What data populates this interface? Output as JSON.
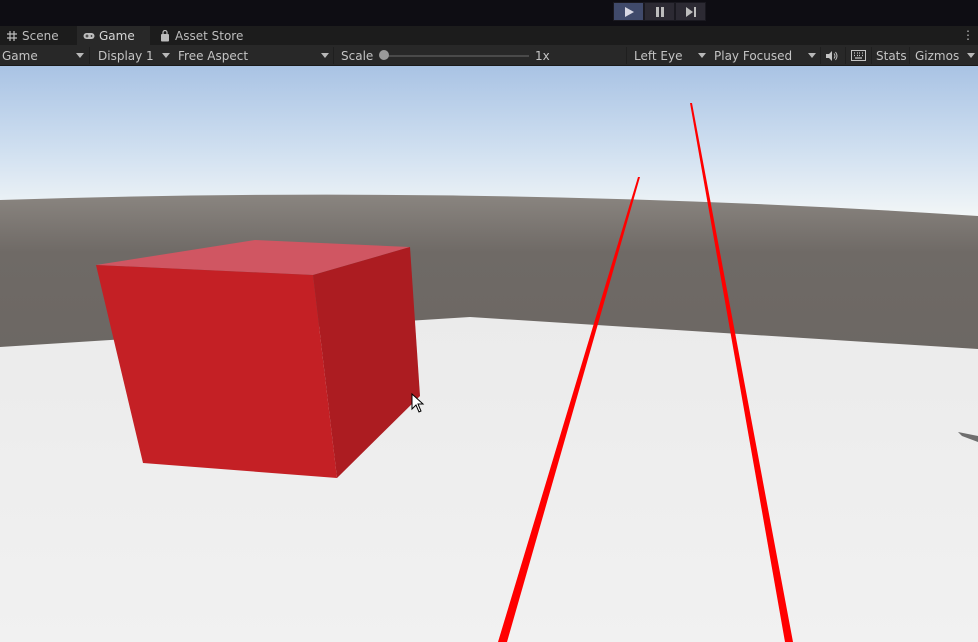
{
  "playbar": {
    "play_icon": "play-icon",
    "pause_icon": "pause-icon",
    "step_icon": "step-icon",
    "active_color": "#404a6b"
  },
  "tabs": [
    {
      "label": "Scene",
      "icon": "grid-icon"
    },
    {
      "label": "Game",
      "icon": "gamepad-icon"
    },
    {
      "label": "Asset Store",
      "icon": "bag-icon"
    }
  ],
  "toolbar": {
    "view_select": "Game",
    "display_select": "Display 1",
    "aspect_select": "Free Aspect",
    "scale_label": "Scale",
    "scale_value": "1x",
    "eye_select": "Left Eye",
    "play_mode_select": "Play Focused",
    "audio_icon": "speaker-icon",
    "keyboard_icon": "keyboard-icon",
    "stats_label": "Stats",
    "gizmos_label": "Gizmos"
  },
  "scene": {
    "sky_top": "#a9c3e4",
    "horizon": "#f2f6f7",
    "ground_far": "#6f6a66",
    "floor": "#f1f1f1",
    "cube_color": "#c42025",
    "laser_color": "#ff0000"
  }
}
